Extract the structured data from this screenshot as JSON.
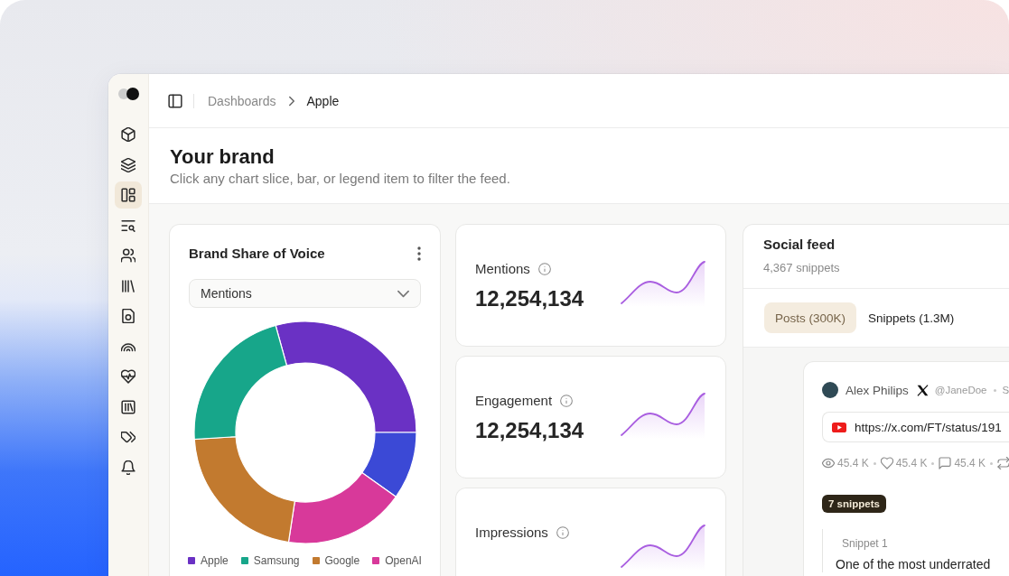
{
  "sidebar": {
    "items": [
      {
        "selected": false
      },
      {
        "selected": false
      },
      {
        "selected": true
      },
      {
        "selected": false
      },
      {
        "selected": false
      },
      {
        "selected": false
      },
      {
        "selected": false
      },
      {
        "selected": false
      },
      {
        "selected": false
      },
      {
        "selected": false
      },
      {
        "selected": false
      },
      {
        "selected": false
      }
    ]
  },
  "breadcrumb": [
    {
      "label": "Dashboards",
      "current": false
    },
    {
      "label": "Apple",
      "current": true
    }
  ],
  "header": {
    "title": "Your brand",
    "subtitle": "Click any chart slice, bar, or legend item to filter the feed."
  },
  "share_of_voice": {
    "title": "Brand Share of Voice",
    "metric_select": {
      "value": "Mentions"
    },
    "legend": [
      {
        "label": "Apple",
        "color": "#6a31c4"
      },
      {
        "label": "Samsung",
        "color": "#17a68a"
      },
      {
        "label": "Google",
        "color": "#c27a2f"
      },
      {
        "label": "OpenAI",
        "color": "#d8399a"
      }
    ]
  },
  "metrics": [
    {
      "label": "Mentions",
      "value": "12,254,134"
    },
    {
      "label": "Engagement",
      "value": "12,254,134"
    },
    {
      "label": "Impressions"
    }
  ],
  "social_feed": {
    "title": "Social feed",
    "count": "4,367 snippets",
    "tabs": [
      {
        "label": "Posts (300K)",
        "selected": true
      },
      {
        "label": "Snippets (1.3M)",
        "selected": false
      }
    ],
    "post": {
      "author": "Alex Philips",
      "handle": "@JaneDoe",
      "meta": "S",
      "url": "https://x.com/FT/status/191",
      "stats": [
        "45.4 K",
        "45.4 K",
        "45.4 K"
      ],
      "badge": "7 snippets",
      "snippet": {
        "label": "Snippet 1",
        "text": "One of the most underrated"
      }
    }
  }
}
